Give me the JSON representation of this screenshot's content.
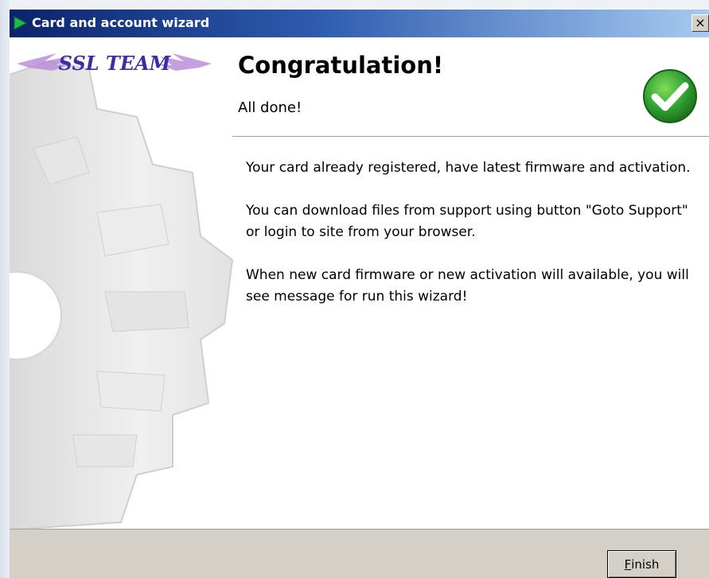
{
  "window": {
    "title": "Card and account wizard",
    "close_glyph": "×"
  },
  "logo": {
    "text": "SSL TEAM",
    "icon": "winged-logo"
  },
  "header": {
    "title": "Congratulation!",
    "subtitle": "All done!",
    "status_icon": "green-check-icon"
  },
  "body": {
    "paragraphs": [
      "Your card already registered, have latest firmware and activation.",
      "You can download files from support using button \"Goto Support\" or login to site from your browser.",
      "When new card firmware or new activation will available, you will see message for run this wizard!"
    ]
  },
  "footer": {
    "finish_mnemonic": "F",
    "finish_rest": "inish"
  },
  "colors": {
    "titlebar_start": "#0a246a",
    "titlebar_end": "#a6caf0",
    "check_green": "#2f9e2f",
    "face": "#d4d0c8"
  }
}
